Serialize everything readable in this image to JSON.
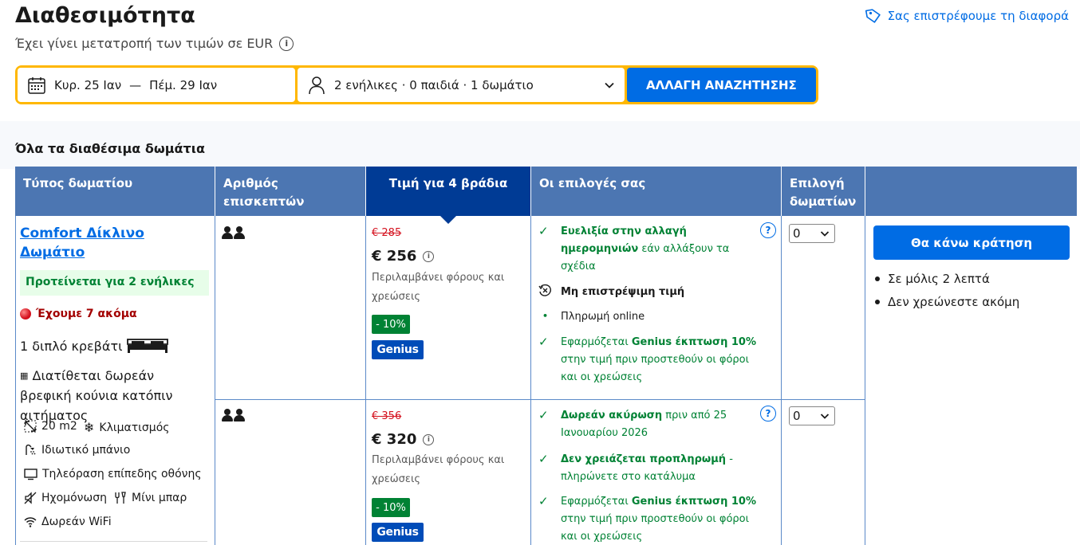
{
  "header": {
    "title": "Διαθεσιμότητα",
    "subtitle": "Έχει γίνει μετατροπή των τιμών σε EUR",
    "price_match": "Σας επιστρέφουμε τη διαφορά"
  },
  "search": {
    "check_in": "Κυρ. 25 Ιαν",
    "separator": "—",
    "check_out": "Πέμ. 29 Ιαν",
    "guests": "2 ενήλικες · 0 παιδιά · 1 δωμάτιο",
    "button": "ΑΛΛΑΓΗ ΑΝΑΖΗΤΗΣΗΣ"
  },
  "rooms_heading": "Όλα τα διαθέσιμα δωμάτια",
  "table_headers": {
    "room_type": "Τύπος δωματίου",
    "guests": "Αριθμός επισκεπτών",
    "price": "Τιμή για 4 βράδια",
    "options": "Οι επιλογές σας",
    "select_rooms": "Επιλογή δωματίων"
  },
  "room": {
    "name": "Comfort Δίκλινο Δωμάτιο",
    "recommended": "Προτείνεται για 2 ενήλικες",
    "scarcity": "Έχουμε 7 ακόμα",
    "bed": "1 διπλό κρεβάτι",
    "crib": "Διατίθεται δωρεάν βρεφική κούνια κατόπιν αιτήματος",
    "amenities": {
      "size": "20 m2",
      "ac": "Κλιματισμός",
      "bathroom": "Ιδιωτικό μπάνιο",
      "tv": "Τηλεόραση επίπεδης οθόνης",
      "soundproof": "Ηχομόνωση",
      "minibar": "Μίνι μπαρ",
      "wifi": "Δωρεάν WiFi"
    }
  },
  "rates": [
    {
      "old_price": "€ 285",
      "price": "€ 256",
      "taxes": "Περιλαμβάνει φόρους και χρεώσεις",
      "discount": "- 10%",
      "genius": "Genius",
      "opt1_bold": "Ευελιξία στην αλλαγή ημερομηνιών",
      "opt1_rest": " εάν αλλάξουν τα σχέδια",
      "opt2": "Μη επιστρέψιμη τιμή",
      "opt3": "Πληρωμή online",
      "opt4_pre": "Εφαρμόζεται ",
      "opt4_bold": "Genius έκπτωση 10%",
      "opt4_rest": " στην τιμή πριν προστεθούν οι φόροι και οι χρεώσεις",
      "qty": "0"
    },
    {
      "old_price": "€ 356",
      "price": "€ 320",
      "taxes": "Περιλαμβάνει φόρους και χρεώσεις",
      "discount": "- 10%",
      "genius": "Genius",
      "opt1_bold": "Δωρεάν ακύρωση",
      "opt1_rest": " πριν από 25 Ιανουαρίου 2026",
      "opt2_bold": "Δεν χρειάζεται προπληρωμή",
      "opt2_rest": " - πληρώνετε στο κατάλυμα",
      "opt3_pre": "Εφαρμόζεται ",
      "opt3_bold": "Genius έκπτωση 10%",
      "opt3_rest": " στην τιμή πριν προστεθούν οι φόροι και οι χρεώσεις",
      "qty": "0"
    }
  ],
  "booking": {
    "button": "Θα κάνω κράτηση",
    "note1": "Σε μόλις 2 λεπτά",
    "note2": "Δεν χρεώνεστε ακόμη"
  }
}
